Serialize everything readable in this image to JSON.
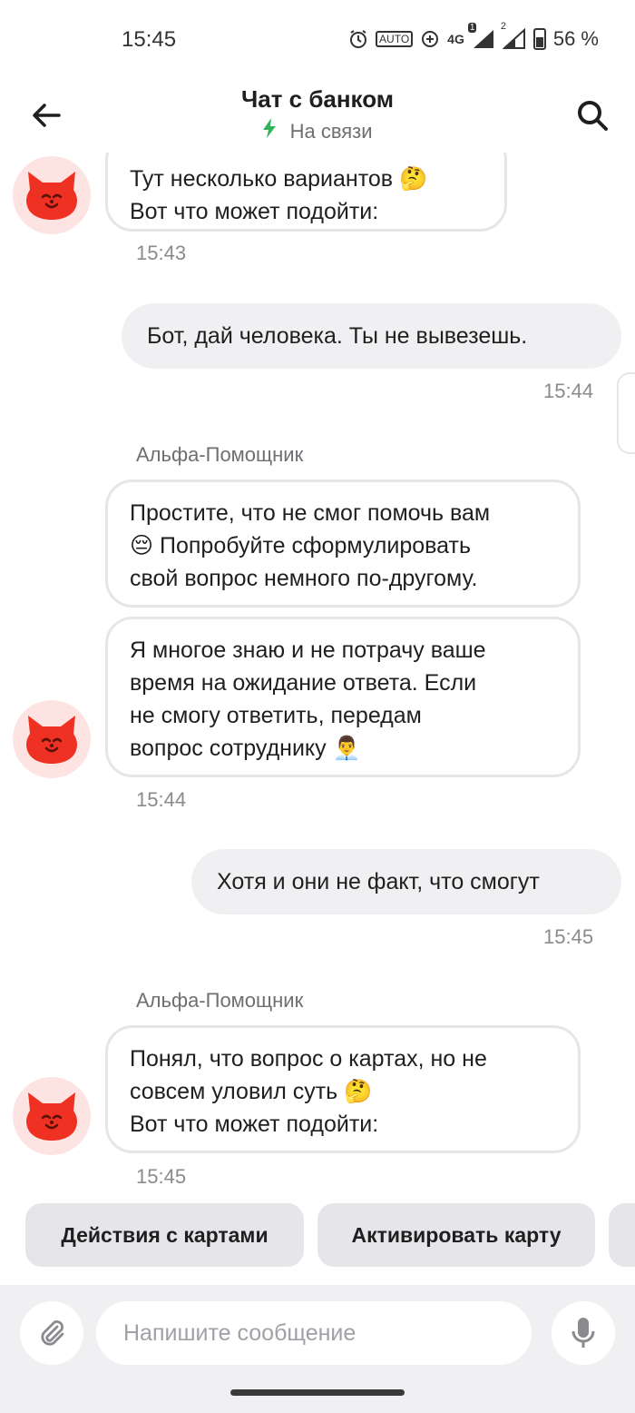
{
  "status_bar": {
    "time": "15:45",
    "network": "4G",
    "sim1": "1",
    "sim2": "2",
    "battery": "56 %",
    "icons": [
      "alarm-icon",
      "auto-hz-icon",
      "data-saver-icon",
      "signal-icon",
      "battery-icon"
    ]
  },
  "header": {
    "title": "Чат с банком",
    "status": "На связи",
    "status_color": "#2fb45a",
    "back_icon": "arrow-left-icon",
    "search_icon": "search-icon"
  },
  "messages": {
    "m1": {
      "line1": "Тут несколько вариантов",
      "emoji1": "🤔",
      "line2": "Вот что может подойти:",
      "time": "15:43"
    },
    "m2": {
      "text": "Бот, дай человека. Ты не вывезешь.",
      "time": "15:44"
    },
    "m3": {
      "sender": "Альфа-Помощник",
      "b1_line1": "Простите, что не смог помочь вам",
      "b1_emoji": "😔",
      "b1_line2": "Попробуйте сформулировать",
      "b1_line3": "свой вопрос немного по-другому.",
      "b2_line1": "Я многое знаю и не потрачу ваше",
      "b2_line2": "время на ожидание ответа. Если",
      "b2_line3": "не смогу ответить, передам",
      "b2_line4": "вопрос сотруднику",
      "b2_emoji": "👨‍💼",
      "time": "15:44"
    },
    "m4": {
      "text": "Хотя и они не факт, что смогут",
      "time": "15:45"
    },
    "m5": {
      "sender": "Альфа-Помощник",
      "line1": "Понял, что вопрос о картах, но не",
      "line2": "совсем уловил суть",
      "emoji": "🤔",
      "line3": "Вот что может подойти:",
      "time": "15:45"
    }
  },
  "quick_replies": [
    "Действия с картами",
    "Активировать карту"
  ],
  "input": {
    "placeholder": "Напишите сообщение",
    "attach_icon": "paperclip-icon",
    "mic_icon": "microphone-icon"
  },
  "colors": {
    "accent_red": "#ef3124",
    "bubble_out": "#f0f0f3",
    "chip": "#e6e6ea"
  }
}
